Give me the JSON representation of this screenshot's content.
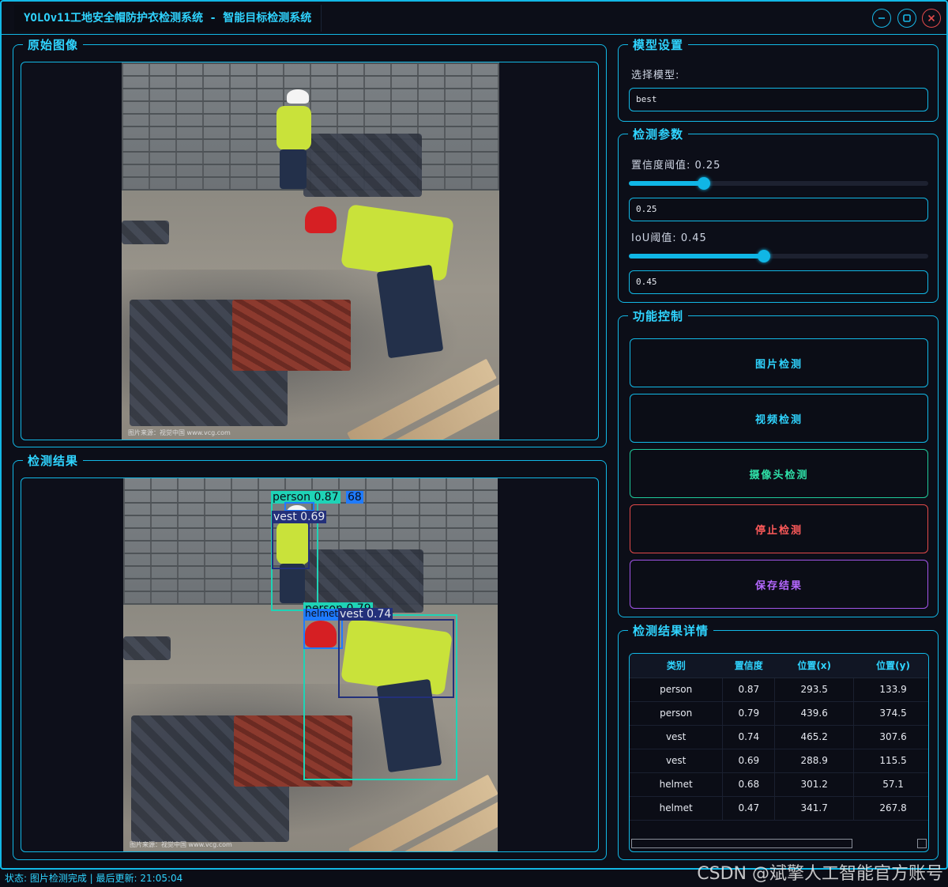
{
  "window": {
    "title": "YOLOv11工地安全帽防护衣检测系统 - 智能目标检测系统"
  },
  "original_panel": {
    "title": "原始图像",
    "caption": "图片来源：视觉中国 www.vcg.com"
  },
  "result_panel": {
    "title": "检测结果",
    "caption": "图片来源：视觉中国 www.vcg.com",
    "boxes": [
      {
        "label": "person 0.87",
        "color": "#1fd3b6"
      },
      {
        "label": "68",
        "color": "#1f7bff"
      },
      {
        "label": "vest 0.69",
        "color": "#23307a"
      },
      {
        "label": "person 0.79",
        "color": "#1fd3b6"
      },
      {
        "label": "helmet",
        "color": "#1f7bff"
      },
      {
        "label": "vest 0.74",
        "color": "#23307a"
      }
    ]
  },
  "model_settings": {
    "title": "模型设置",
    "select_label": "选择模型:",
    "selected_model": "best"
  },
  "detect_params": {
    "title": "检测参数",
    "conf_label": "置信度阈值: 0.25",
    "conf_value": "0.25",
    "conf_fraction": 0.25,
    "iou_label": "IoU阈值: 0.45",
    "iou_value": "0.45",
    "iou_fraction": 0.45
  },
  "controls": {
    "title": "功能控制",
    "image_detect": "图片检测",
    "video_detect": "视频检测",
    "camera_detect": "摄像头检测",
    "stop_detect": "停止检测",
    "save_result": "保存结果"
  },
  "details": {
    "title": "检测结果详情",
    "columns": [
      "类别",
      "置信度",
      "位置(x)",
      "位置(y)"
    ],
    "rows": [
      [
        "person",
        "0.87",
        "293.5",
        "133.9"
      ],
      [
        "person",
        "0.79",
        "439.6",
        "374.5"
      ],
      [
        "vest",
        "0.74",
        "465.2",
        "307.6"
      ],
      [
        "vest",
        "0.69",
        "288.9",
        "115.5"
      ],
      [
        "helmet",
        "0.68",
        "301.2",
        "57.1"
      ],
      [
        "helmet",
        "0.47",
        "341.7",
        "267.8"
      ]
    ]
  },
  "status": {
    "text": "状态: 图片检测完成 | 最后更新: 21:05:04"
  },
  "watermark": "CSDN @斌擎人工智能官方账号",
  "colors": {
    "accent": "#12b8e6",
    "image_btn": "#12b8e6",
    "camera_btn": "#1fc99a",
    "stop_btn": "#e24a4a",
    "save_btn": "#a255e8"
  }
}
